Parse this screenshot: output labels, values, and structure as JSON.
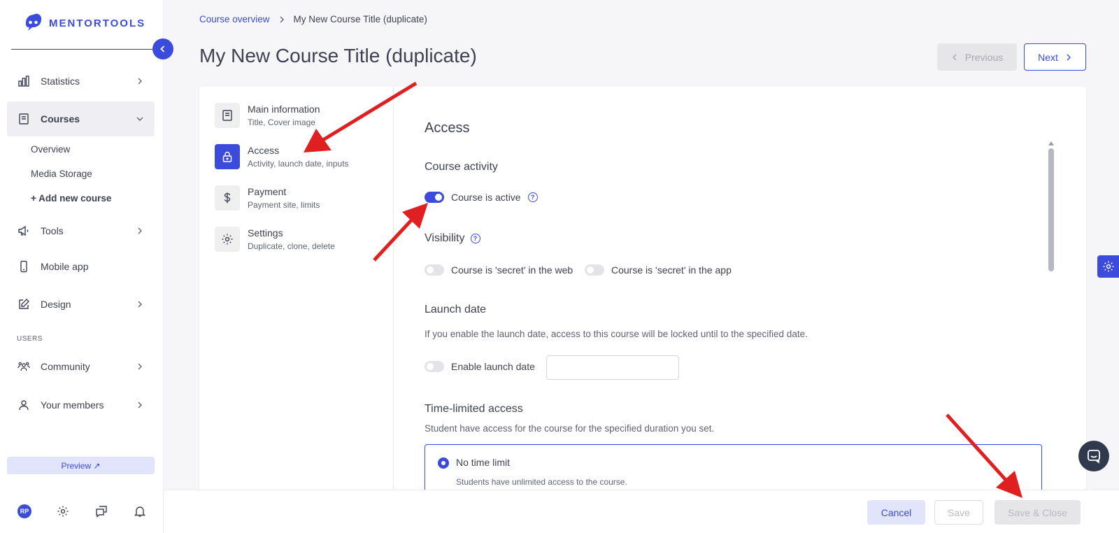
{
  "brand": {
    "name": "MENTORTOOLS",
    "color": "#3b4bdb"
  },
  "sidebar": {
    "items": [
      {
        "label": "Statistics",
        "icon": "bar-chart-icon"
      },
      {
        "label": "Courses",
        "icon": "book-icon"
      },
      {
        "label": "Tools",
        "icon": "megaphone-icon"
      },
      {
        "label": "Mobile app",
        "icon": "mobile-icon"
      },
      {
        "label": "Design",
        "icon": "edit-icon"
      },
      {
        "label": "Community",
        "icon": "community-icon"
      },
      {
        "label": "Your members",
        "icon": "user-icon"
      }
    ],
    "courses_sub": [
      "Overview",
      "Media Storage",
      "+ Add new course"
    ],
    "section_users": "USERS",
    "preview_label": "Preview ↗",
    "avatar_initials": "RP"
  },
  "header": {
    "breadcrumb_link": "Course overview",
    "breadcrumb_current": "My New Course Title (duplicate)",
    "title": "My New Course Title (duplicate)",
    "prev_label": "Previous",
    "next_label": "Next"
  },
  "steps": [
    {
      "title": "Main information",
      "sub": "Title, Cover image",
      "icon": "book-icon"
    },
    {
      "title": "Access",
      "sub": "Activity, launch date, inputs",
      "icon": "lock-icon"
    },
    {
      "title": "Payment",
      "sub": "Payment site, limits",
      "icon": "dollar-icon"
    },
    {
      "title": "Settings",
      "sub": "Duplicate, clone, delete",
      "icon": "gear-icon"
    }
  ],
  "access": {
    "title": "Access",
    "activity_heading": "Course activity",
    "active_label": "Course is active",
    "visibility_heading": "Visibility",
    "secret_web": "Course is 'secret' in the web",
    "secret_app": "Course is 'secret' in the app",
    "launch_heading": "Launch date",
    "launch_desc": "If you enable the launch date, access to this course will be locked until to the specified date.",
    "enable_launch": "Enable launch date",
    "launch_date_value": "",
    "time_heading": "Time-limited access",
    "time_desc": "Student have access for the course for the specified duration you set.",
    "no_limit_title": "No time limit",
    "no_limit_desc": "Students have unlimited access to the course."
  },
  "footer": {
    "cancel": "Cancel",
    "save": "Save",
    "save_close": "Save & Close"
  },
  "annotation_color": "#e02020"
}
